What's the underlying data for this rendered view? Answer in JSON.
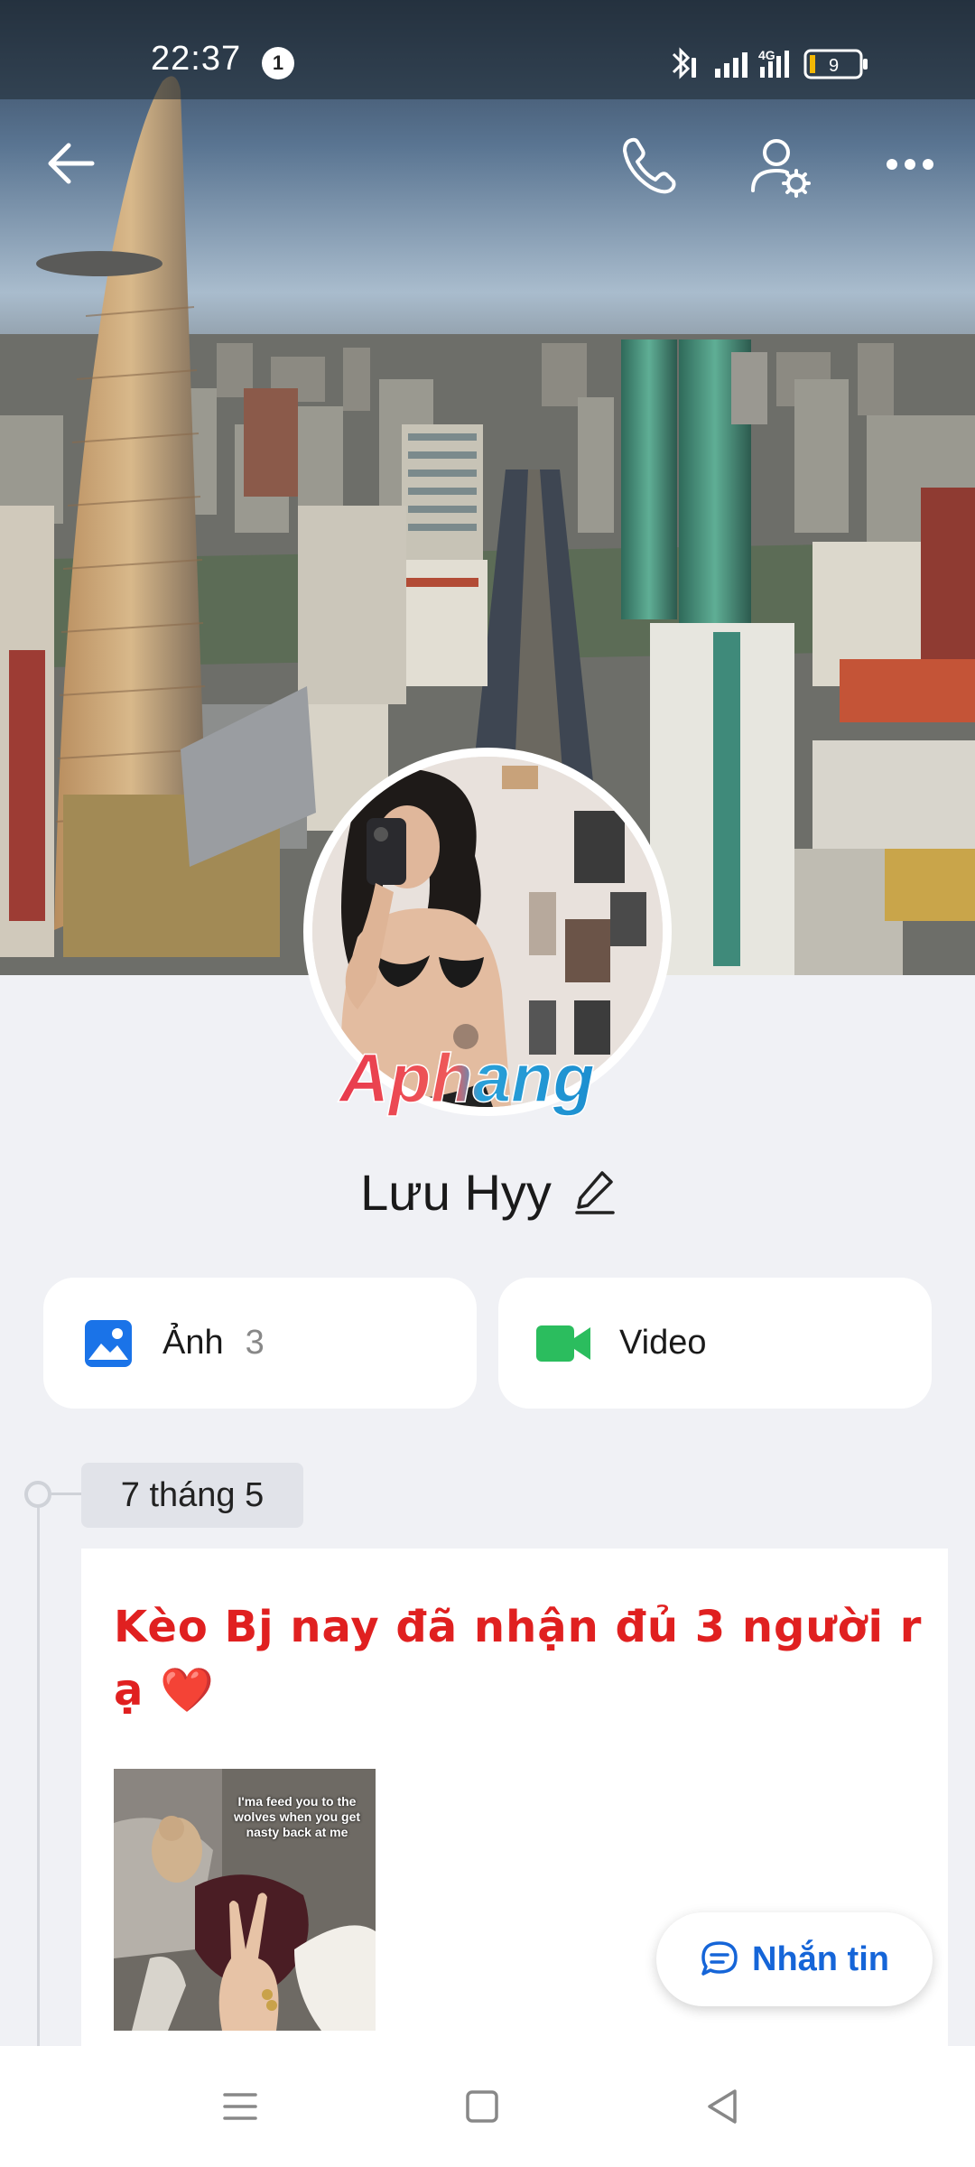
{
  "status_bar": {
    "time": "22:37",
    "notification_count": "1",
    "network": "4G",
    "battery": "9"
  },
  "profile": {
    "name": "Lưu Hyy",
    "watermark": "Aphang"
  },
  "media": {
    "photos_label": "Ảnh",
    "photos_count": "3",
    "video_label": "Video"
  },
  "timeline": {
    "date": "7 tháng 5",
    "post_text": "Kèo Bj nay đã nhận đủ 3 người r ạ ❤️",
    "image_caption": "I'ma feed you to the wolves when you get nasty back at me"
  },
  "actions": {
    "message_label": "Nhắn tin"
  },
  "colors": {
    "accent": "#1565d8",
    "post_text": "#e02020",
    "video_green": "#2bbd5e",
    "photo_blue": "#1a73e8"
  }
}
